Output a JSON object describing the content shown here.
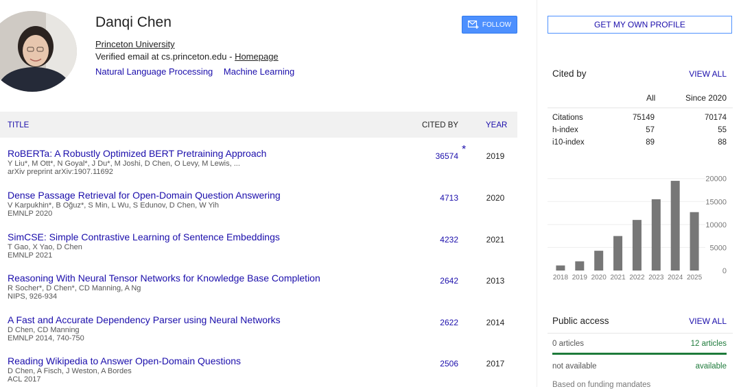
{
  "profile": {
    "name": "Danqi Chen",
    "affiliation": "Princeton University",
    "email_text": "Verified email at cs.princeton.edu - ",
    "homepage": "Homepage",
    "interests": [
      "Natural Language Processing",
      "Machine Learning"
    ],
    "follow_label": "FOLLOW"
  },
  "table": {
    "headers": {
      "title": "TITLE",
      "cited_by": "CITED BY",
      "year": "YEAR"
    },
    "rows": [
      {
        "title": "RoBERTa: A Robustly Optimized BERT Pretraining Approach",
        "authors": "Y Liu*, M Ott*, N Goyal*, J Du*, M Joshi, D Chen, O Levy, M Lewis, ...",
        "venue": "arXiv preprint arXiv:1907.11692",
        "cited": "36574",
        "year": "2019",
        "star": "*"
      },
      {
        "title": "Dense Passage Retrieval for Open-Domain Question Answering",
        "authors": "V Karpukhin*, B Oğuz*, S Min, L Wu, S Edunov, D Chen, W Yih",
        "venue": "EMNLP 2020",
        "cited": "4713",
        "year": "2020"
      },
      {
        "title": "SimCSE: Simple Contrastive Learning of Sentence Embeddings",
        "authors": "T Gao, X Yao, D Chen",
        "venue": "EMNLP 2021",
        "cited": "4232",
        "year": "2021"
      },
      {
        "title": "Reasoning With Neural Tensor Networks for Knowledge Base Completion",
        "authors": "R Socher*, D Chen*, CD Manning, A Ng",
        "venue": "NIPS, 926-934",
        "cited": "2642",
        "year": "2013"
      },
      {
        "title": "A Fast and Accurate Dependency Parser using Neural Networks",
        "authors": "D Chen, CD Manning",
        "venue": "EMNLP 2014, 740-750",
        "cited": "2622",
        "year": "2014"
      },
      {
        "title": "Reading Wikipedia to Answer Open-Domain Questions",
        "authors": "D Chen, A Fisch, J Weston, A Bordes",
        "venue": "ACL 2017",
        "cited": "2506",
        "year": "2017"
      }
    ]
  },
  "sidebar": {
    "own_profile_label": "GET MY OWN PROFILE",
    "cited_by": {
      "title": "Cited by",
      "view_all": "VIEW ALL",
      "col_all": "All",
      "col_since": "Since 2020",
      "metrics": [
        {
          "label": "Citations",
          "all": "75149",
          "since": "70174"
        },
        {
          "label": "h-index",
          "all": "57",
          "since": "55"
        },
        {
          "label": "i10-index",
          "all": "89",
          "since": "88"
        }
      ]
    },
    "public_access": {
      "title": "Public access",
      "view_all": "VIEW ALL",
      "left": "0 articles",
      "right": "12 articles",
      "left2": "not available",
      "right2": "available",
      "footer": "Based on funding mandates"
    }
  },
  "chart_data": {
    "type": "bar",
    "categories": [
      "2018",
      "2019",
      "2020",
      "2021",
      "2022",
      "2023",
      "2024",
      "2025"
    ],
    "values": [
      1100,
      2000,
      4300,
      7500,
      11000,
      15500,
      19500,
      12700
    ],
    "yticks": [
      "20000",
      "15000",
      "10000",
      "5000",
      "0"
    ],
    "ylim": [
      0,
      21000
    ],
    "bar_color": "#777777"
  },
  "colors": {
    "link": "#1a0dab",
    "follow": "#4d90fe",
    "available": "#1d7a3a"
  }
}
